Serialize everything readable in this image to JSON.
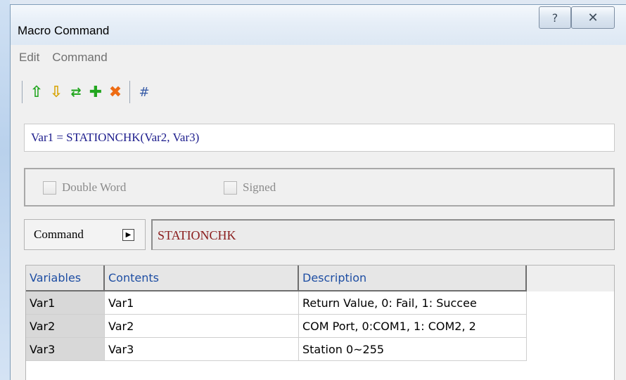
{
  "window": {
    "title": "Macro Command",
    "help_symbol": "?",
    "close_symbol": "✕"
  },
  "menu": {
    "items": [
      "Edit",
      "Command"
    ]
  },
  "toolbar": {
    "buttons": [
      {
        "icon": "move-up-icon",
        "glyph": "⇧",
        "color": "#22a61f"
      },
      {
        "icon": "move-down-icon",
        "glyph": "⇩",
        "color": "#d8a508"
      },
      {
        "icon": "replace-icon",
        "glyph": "⇄",
        "color": "#22a61f"
      },
      {
        "icon": "add-icon",
        "glyph": "✚",
        "color": "#22a61f"
      },
      {
        "icon": "delete-icon",
        "glyph": "✖",
        "color": "#ee6b12"
      },
      {
        "icon": "hash-icon",
        "glyph": "#",
        "color": "#3a5ea8"
      }
    ]
  },
  "expression": "Var1 = STATIONCHK(Var2, Var3)",
  "options": {
    "double_word": {
      "label": "Double Word",
      "checked": false
    },
    "signed": {
      "label": "Signed",
      "checked": false
    }
  },
  "command": {
    "button_label": "Command",
    "arrow_symbol": "▶",
    "value": "STATIONCHK"
  },
  "table": {
    "columns": [
      "Variables",
      "Contents",
      "Description"
    ],
    "rows": [
      [
        "Var1",
        "Var1",
        "Return Value, 0: Fail, 1: Succee"
      ],
      [
        "Var2",
        "Var2",
        "COM Port, 0:COM1, 1: COM2, 2"
      ],
      [
        "Var3",
        "Var3",
        "Station 0~255"
      ]
    ]
  }
}
